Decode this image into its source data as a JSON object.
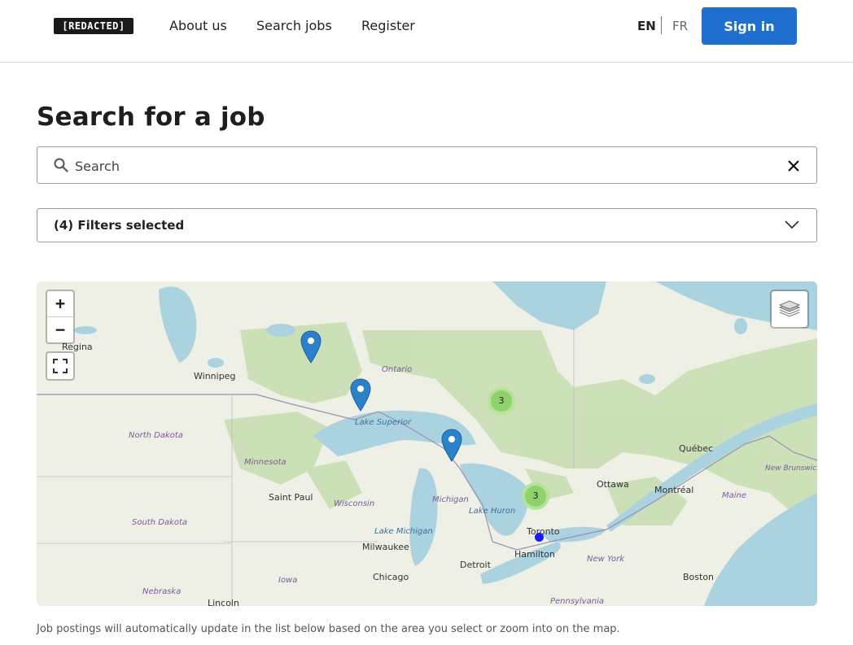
{
  "header": {
    "logo_text": "[REDACTED]",
    "nav": [
      "About us",
      "Search jobs",
      "Register"
    ],
    "lang_en": "EN",
    "lang_fr": "FR",
    "signin_label": "Sign in"
  },
  "page": {
    "title": "Search for a job",
    "search_placeholder": "Search",
    "filters_label": "(4) Filters selected",
    "footnote": "Job postings will automatically update in the list below based on the area you select or zoom into on the map."
  },
  "map": {
    "zoom_in": "+",
    "zoom_out": "−",
    "labels": {
      "regina": "Regina",
      "winnipeg": "Winnipeg",
      "ontario": "Ontario",
      "north_dakota": "North Dakota",
      "minnesota": "Minnesota",
      "lake_superior": "Lake Superior",
      "saint_paul": "Saint Paul",
      "wisconsin": "Wisconsin",
      "michigan": "Michigan",
      "lake_huron": "Lake Huron",
      "south_dakota": "South Dakota",
      "lake_michigan": "Lake Michigan",
      "milwaukee": "Milwaukee",
      "detroit": "Detroit",
      "toronto": "Toronto",
      "hamilton": "Hamilton",
      "iowa": "Iowa",
      "chicago": "Chicago",
      "nebraska": "Nebraska",
      "lincoln": "Lincoln",
      "pennsylvania": "Pennsylvania",
      "new_york": "New York",
      "ottawa": "Ottawa",
      "montreal": "Montréal",
      "quebec": "Québec",
      "maine": "Maine",
      "boston": "Boston",
      "new_brunswick": "New Brunswick"
    },
    "clusters": [
      "3",
      "3"
    ],
    "marker_count": 3,
    "colors": {
      "water": "#aad3df",
      "land": "#eef0e6",
      "forest": "#c8dfb3",
      "marker": "#2b82cb",
      "cluster_fill": "#8fd16a",
      "cluster_ring": "#b6e29a",
      "user_location": "#1a1aff"
    }
  }
}
